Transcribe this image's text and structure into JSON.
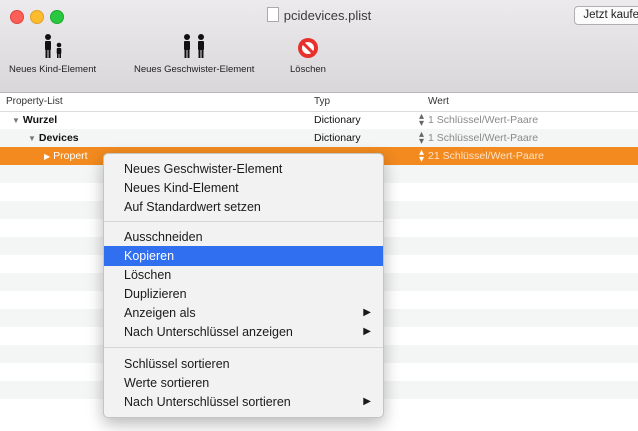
{
  "window": {
    "title": "pcidevices.plist",
    "buy_button": "Jetzt kaufe"
  },
  "toolbar": {
    "items": [
      {
        "label": "Neues Kind-Element",
        "icon": "new-child-icon"
      },
      {
        "label": "Neues Geschwister-Element",
        "icon": "new-sibling-icon"
      },
      {
        "label": "Löschen",
        "icon": "delete-icon"
      }
    ]
  },
  "columns": {
    "property": "Property-List",
    "type": "Typ",
    "value": "Wert"
  },
  "rows": [
    {
      "key": "Wurzel",
      "type": "Dictionary",
      "value": "1 Schlüssel/Wert-Paare",
      "disclosure": "expanded"
    },
    {
      "key": "Devices",
      "type": "Dictionary",
      "value": "1 Schlüssel/Wert-Paare",
      "disclosure": "expanded"
    },
    {
      "key": "Propert",
      "type": "",
      "value": "21 Schlüssel/Wert-Paare",
      "disclosure": "collapsed",
      "selected": true
    }
  ],
  "context_menu": {
    "items": [
      {
        "label": "Neues Geschwister-Element"
      },
      {
        "label": "Neues Kind-Element"
      },
      {
        "label": "Auf Standardwert setzen"
      },
      {
        "label": "Ausschneiden"
      },
      {
        "label": "Kopieren",
        "highlighted": true
      },
      {
        "label": "Löschen"
      },
      {
        "label": "Duplizieren"
      },
      {
        "label": "Anzeigen als",
        "submenu": true
      },
      {
        "label": "Nach Unterschlüssel anzeigen",
        "submenu": true
      },
      {
        "label": "Schlüssel sortieren"
      },
      {
        "label": "Werte sortieren"
      },
      {
        "label": "Nach Unterschlüssel sortieren",
        "submenu": true
      }
    ]
  },
  "colors": {
    "selection_row": "#f28a1f",
    "menu_highlight": "#2f6ff0"
  }
}
